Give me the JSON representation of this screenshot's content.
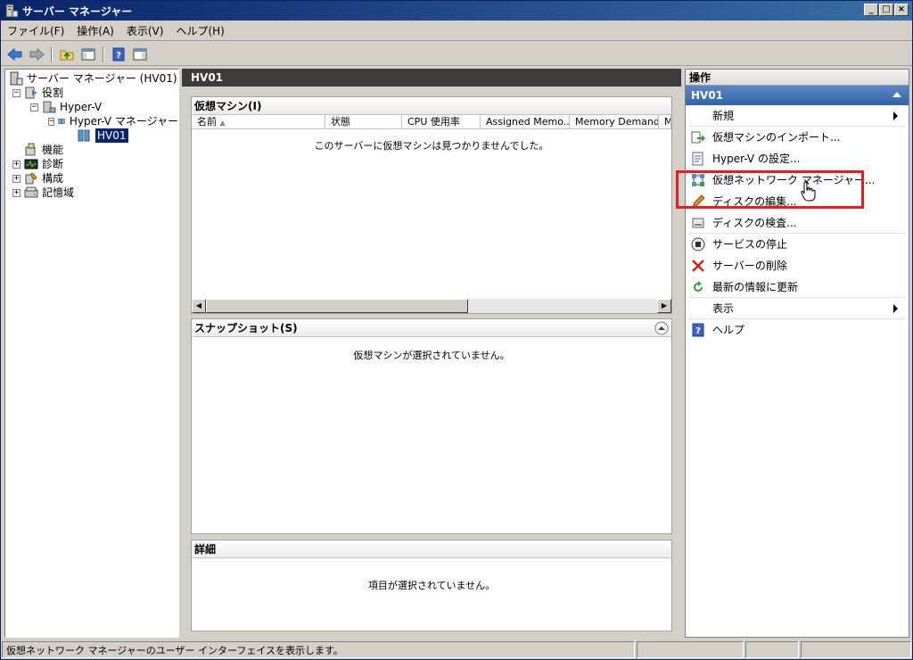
{
  "window": {
    "title": "サーバー マネージャー"
  },
  "menu": [
    "ファイル(F)",
    "操作(A)",
    "表示(V)",
    "ヘルプ(H)"
  ],
  "toolbar": {
    "icons": [
      "back-icon",
      "forward-icon",
      "up-folder-icon",
      "show-hide-tree-icon",
      "help-icon",
      "show-hide-action-pane-icon"
    ]
  },
  "tree": {
    "root": "サーバー マネージャー (HV01)",
    "roles": "役割",
    "hyperv": "Hyper-V",
    "hyperv_manager": "Hyper-V マネージャー",
    "hv01": "HV01",
    "features": "機能",
    "diagnostics": "診断",
    "configuration": "構成",
    "storage": "記憶域"
  },
  "center": {
    "header": "HV01",
    "vm_section": {
      "title": "仮想マシン(I)",
      "columns": [
        "名前",
        "状態",
        "CPU 使用率",
        "Assigned Memo...",
        "Memory Demand",
        "M"
      ],
      "empty_message": "このサーバーに仮想マシンは見つかりませんでした。"
    },
    "snapshot_section": {
      "title": "スナップショット(S)",
      "empty_message": "仮想マシンが選択されていません。"
    },
    "details_section": {
      "title": "詳細",
      "empty_message": "項目が選択されていません。"
    }
  },
  "actions": {
    "header": "操作",
    "group": "HV01",
    "items": [
      {
        "label": "新規",
        "icon": "",
        "submenu": true
      },
      {
        "label": "仮想マシンのインポート...",
        "icon": "import-vm-icon"
      },
      {
        "label": "Hyper-V の設定...",
        "icon": "settings-icon"
      },
      {
        "label": "仮想ネットワーク マネージャー...",
        "icon": "virtual-network-icon"
      },
      {
        "label": "ディスクの編集...",
        "icon": "edit-disk-icon"
      },
      {
        "label": "ディスクの検査...",
        "icon": "inspect-disk-icon"
      },
      {
        "label": "サービスの停止",
        "icon": "stop-service-icon"
      },
      {
        "label": "サーバーの削除",
        "icon": "remove-server-icon"
      },
      {
        "label": "最新の情報に更新",
        "icon": "refresh-icon"
      },
      {
        "label": "表示",
        "icon": "",
        "submenu": true
      },
      {
        "label": "ヘルプ",
        "icon": "help-icon"
      }
    ]
  },
  "statusbar": {
    "text": "仮想ネットワーク マネージャーのユーザー インターフェイスを表示します。"
  },
  "colors": {
    "highlight": "#e01e26",
    "title_bar": "#0a246a",
    "action_group": "#3564a6"
  }
}
